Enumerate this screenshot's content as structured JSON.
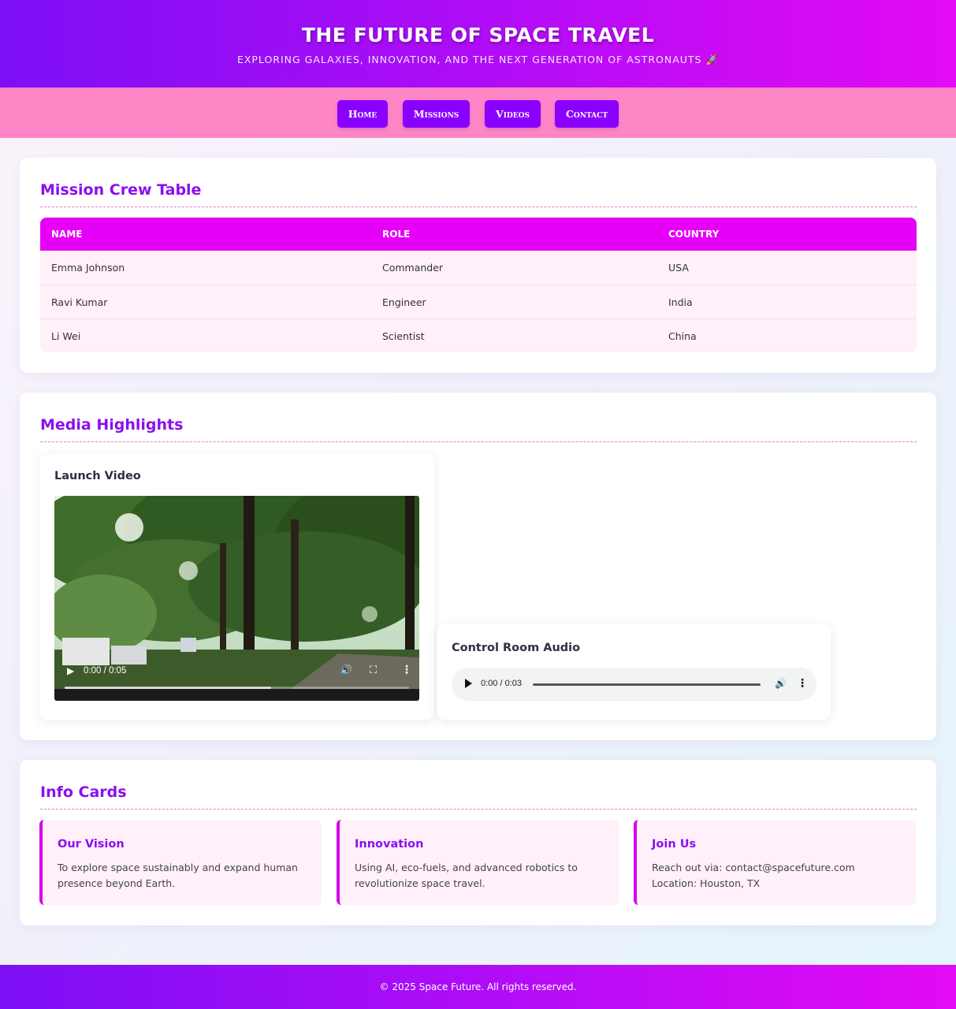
{
  "header": {
    "title": "THE FUTURE OF SPACE TRAVEL",
    "subtitle": "EXPLORING GALAXIES, INNOVATION, AND THE NEXT GENERATION OF ASTRONAUTS 🚀"
  },
  "nav": {
    "items": [
      {
        "label": "Home"
      },
      {
        "label": "Missions"
      },
      {
        "label": "Videos"
      },
      {
        "label": "Contact"
      }
    ]
  },
  "crew_section": {
    "title": "Mission Crew Table",
    "columns": [
      "NAME",
      "ROLE",
      "COUNTRY"
    ],
    "rows": [
      [
        "Emma Johnson",
        "Commander",
        "USA"
      ],
      [
        "Ravi Kumar",
        "Engineer",
        "India"
      ],
      [
        "Li Wei",
        "Scientist",
        "China"
      ]
    ]
  },
  "media_section": {
    "title": "Media Highlights",
    "video": {
      "title": "Launch Video",
      "time": "0:00 / 0:05",
      "progress": 0.6
    },
    "audio": {
      "title": "Control Room Audio",
      "time": "0:00 / 0:03"
    }
  },
  "info_section": {
    "title": "Info Cards",
    "cards": [
      {
        "title": "Our Vision",
        "text": "To explore space sustainably and expand human presence beyond Earth."
      },
      {
        "title": "Innovation",
        "text": "Using AI, eco-fuels, and advanced robotics to revolutionize space travel."
      },
      {
        "title": "Join Us",
        "line1": "Reach out via: contact@spacefuture.com",
        "line2": "Location: Houston, TX"
      }
    ]
  },
  "footer": {
    "text": "© 2025 Space Future. All rights reserved."
  },
  "colors": {
    "accent": "#8a00ff",
    "magenta": "#e600f8",
    "nav_bg": "#ff86c6",
    "card_bg": "#fff0fa"
  }
}
